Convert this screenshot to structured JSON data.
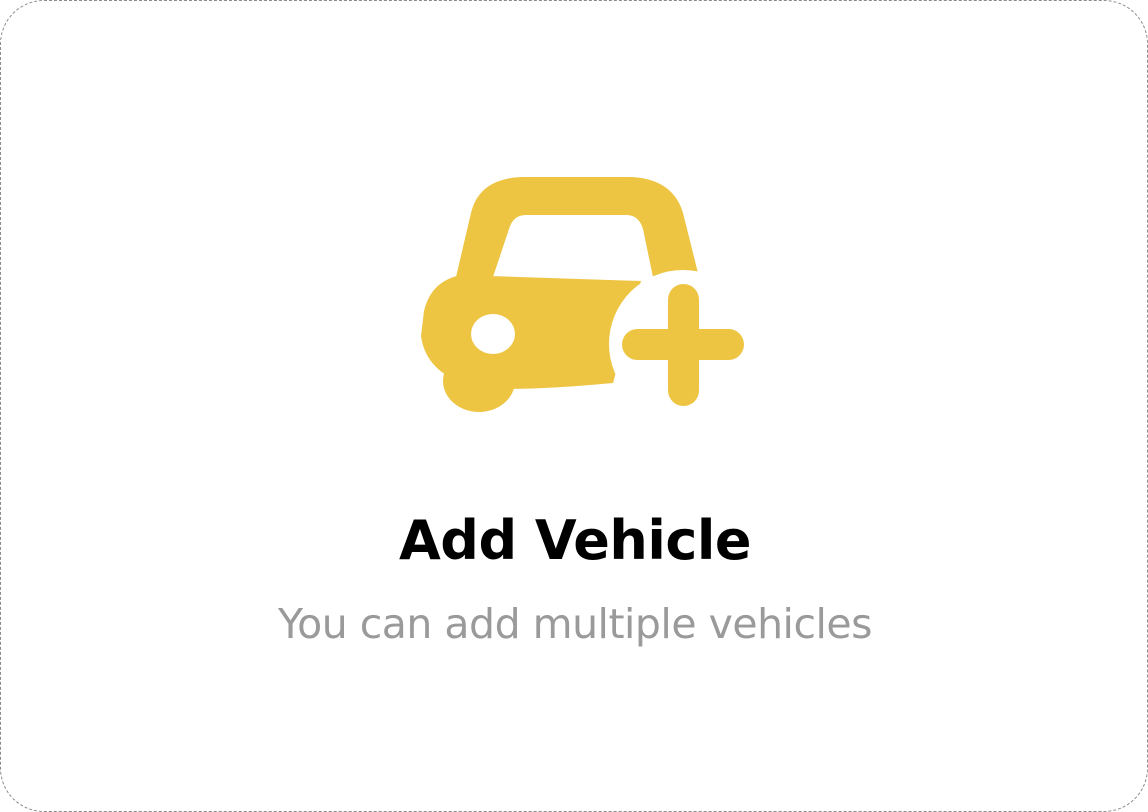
{
  "card": {
    "title": "Add Vehicle",
    "subtitle": "You can add multiple vehicles",
    "icon": "car-add-icon"
  },
  "colors": {
    "accent": "#EEC543",
    "title": "#000000",
    "subtitle": "#9A9A9A",
    "border": "#8A8A8A"
  }
}
